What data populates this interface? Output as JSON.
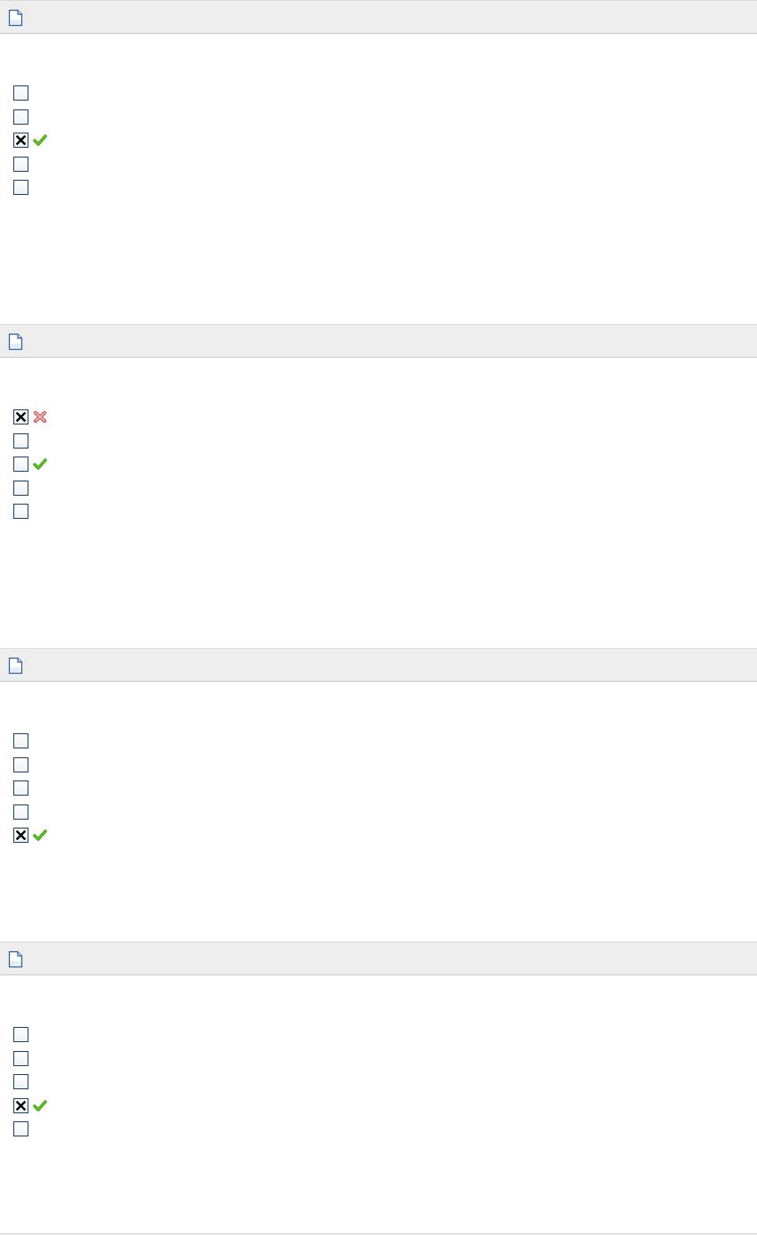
{
  "colors": {
    "header_bg": "#eeeeee",
    "checkbox_border": "#1c3f6e",
    "correct_mark": "#5cc41a",
    "incorrect_mark": "#e07070"
  },
  "icons": {
    "header": "document-icon",
    "correct": "green-check-icon",
    "incorrect": "red-cross-icon"
  },
  "questions": [
    {
      "options": [
        {
          "checked": false,
          "mark": "none"
        },
        {
          "checked": false,
          "mark": "none"
        },
        {
          "checked": true,
          "mark": "correct"
        },
        {
          "checked": false,
          "mark": "none"
        },
        {
          "checked": false,
          "mark": "none"
        }
      ]
    },
    {
      "options": [
        {
          "checked": true,
          "mark": "incorrect"
        },
        {
          "checked": false,
          "mark": "none"
        },
        {
          "checked": false,
          "mark": "correct"
        },
        {
          "checked": false,
          "mark": "none"
        },
        {
          "checked": false,
          "mark": "none"
        }
      ]
    },
    {
      "options": [
        {
          "checked": false,
          "mark": "none"
        },
        {
          "checked": false,
          "mark": "none"
        },
        {
          "checked": false,
          "mark": "none"
        },
        {
          "checked": false,
          "mark": "none"
        },
        {
          "checked": true,
          "mark": "correct"
        }
      ]
    },
    {
      "options": [
        {
          "checked": false,
          "mark": "none"
        },
        {
          "checked": false,
          "mark": "none"
        },
        {
          "checked": false,
          "mark": "none"
        },
        {
          "checked": true,
          "mark": "correct"
        },
        {
          "checked": false,
          "mark": "none"
        }
      ]
    }
  ]
}
